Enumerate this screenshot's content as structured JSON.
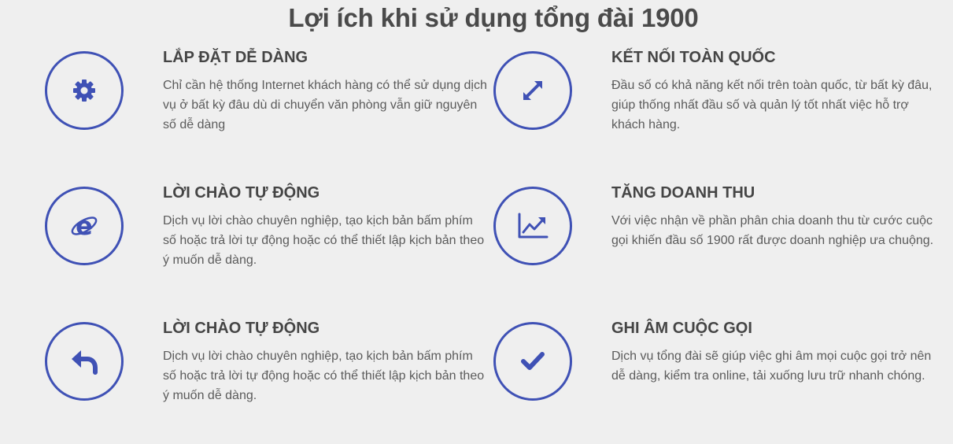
{
  "section_title": "Lợi ích khi sử dụng tổng đài 1900",
  "accent_color": "#3f51b5",
  "features": [
    {
      "icon": "gear-icon",
      "title": "LẮP ĐẶT DỄ DÀNG",
      "description": "Chỉ cần hệ thống Internet khách hàng có thể sử dụng dịch vụ ở bất kỳ đâu dù di chuyển văn phòng vẫn giữ nguyên số dễ dàng"
    },
    {
      "icon": "expand-arrows-icon",
      "title": "KẾT NỐI TOÀN QUỐC",
      "description": "Đầu số có khả năng kết nối trên toàn quốc, từ bất kỳ đâu, giúp thống nhất đầu số và quản lý tốt nhất việc hỗ trợ khách hàng."
    },
    {
      "icon": "internet-explorer-icon",
      "title": "LỜI CHÀO TỰ ĐỘNG",
      "description": "Dịch vụ lời chào chuyên nghiệp, tạo kịch bản bấm phím số hoặc trả lời tự động hoặc có thể thiết lập kịch bản theo ý muốn dễ dàng."
    },
    {
      "icon": "line-chart-icon",
      "title": "TĂNG DOANH THU",
      "description": "Với việc nhận về phần phân chia doanh thu từ cước cuộc gọi khiến đầu số 1900 rất được doanh nghiệp ưa chuộng."
    },
    {
      "icon": "reply-arrow-icon",
      "title": "LỜI CHÀO TỰ ĐỘNG",
      "description": "Dịch vụ lời chào chuyên nghiệp, tạo kịch bản bấm phím số hoặc trả lời tự động hoặc có thể thiết lập kịch bản theo ý muốn dễ dàng."
    },
    {
      "icon": "checkmark-icon",
      "title": "GHI ÂM CUỘC GỌI",
      "description": "Dịch vụ tổng đài sẽ giúp việc ghi âm mọi cuộc gọi trở nên dễ dàng, kiểm tra online, tải xuống lưu trữ nhanh chóng."
    }
  ]
}
